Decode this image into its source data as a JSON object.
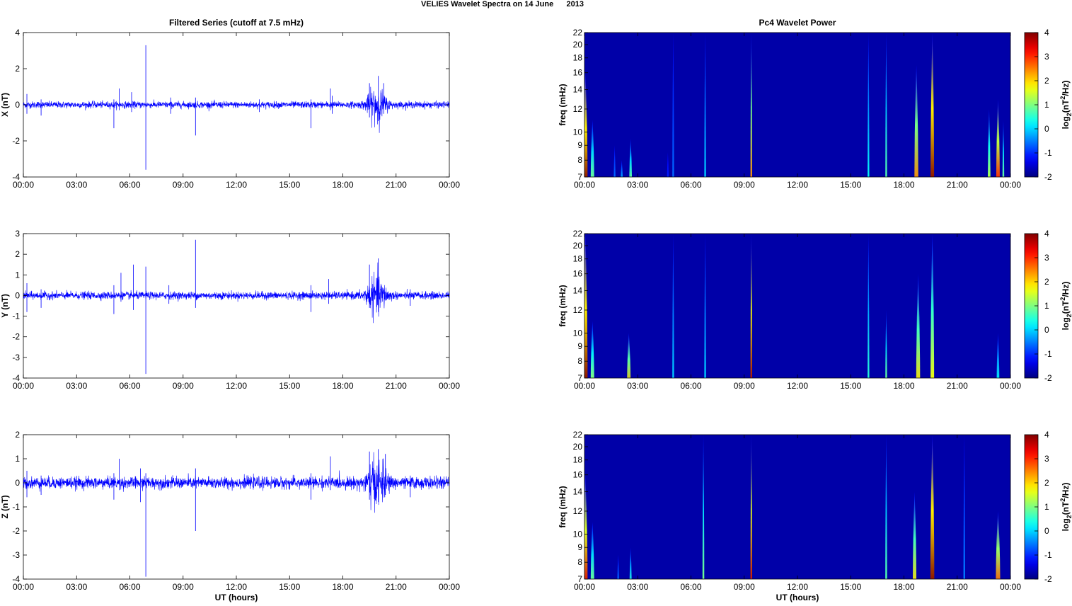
{
  "title": "VELIES Wavelet Spectra on 14 June      2013",
  "chart_data": [
    {
      "type": "line",
      "title": "Filtered Series (cutoff at 7.5 mHz)",
      "xlabel": "",
      "ylabel": "X (nT)",
      "xticks": [
        "00:00",
        "03:00",
        "06:00",
        "09:00",
        "12:00",
        "15:00",
        "18:00",
        "21:00",
        "00:00"
      ],
      "xlim": [
        0,
        24
      ],
      "ylim": [
        -4,
        4
      ],
      "yticks": [
        4,
        2,
        0,
        -2,
        -4
      ],
      "color": "#0000ff",
      "noise_std": 0.09,
      "burst": {
        "center_hour": 19.9,
        "width_hours": 0.5,
        "amplitude": 0.45
      },
      "spikes": [
        [
          0.2,
          0.6,
          -0.5
        ],
        [
          1.0,
          0.3,
          -0.6
        ],
        [
          5.1,
          0.3,
          -1.3
        ],
        [
          5.4,
          0.9,
          -0.3
        ],
        [
          6.1,
          0.7,
          -0.4
        ],
        [
          6.9,
          3.3,
          -3.6
        ],
        [
          8.3,
          0.4,
          -0.5
        ],
        [
          9.7,
          0.4,
          -1.7
        ],
        [
          13.3,
          0.3,
          -0.4
        ],
        [
          16.2,
          0.3,
          -1.3
        ],
        [
          17.3,
          0.9,
          -0.3
        ],
        [
          17.4,
          0.5,
          -0.5
        ],
        [
          19.5,
          1.2,
          -0.7
        ],
        [
          20.0,
          1.6,
          -0.9
        ],
        [
          20.3,
          1.2,
          -0.5
        ]
      ]
    },
    {
      "type": "line",
      "xlabel": "",
      "ylabel": "Y (nT)",
      "xticks": [
        "00:00",
        "03:00",
        "06:00",
        "09:00",
        "12:00",
        "15:00",
        "18:00",
        "21:00",
        "00:00"
      ],
      "xlim": [
        0,
        24
      ],
      "ylim": [
        -4,
        3
      ],
      "yticks": [
        3,
        2,
        1,
        0,
        -1,
        -2,
        -3,
        -4
      ],
      "color": "#0000ff",
      "noise_std": 0.09,
      "burst": {
        "center_hour": 19.9,
        "width_hours": 0.55,
        "amplitude": 0.4
      },
      "spikes": [
        [
          0.2,
          0.6,
          -0.8
        ],
        [
          1.0,
          0.3,
          -0.6
        ],
        [
          5.1,
          0.5,
          -0.9
        ],
        [
          5.5,
          1.1,
          -0.3
        ],
        [
          6.2,
          1.5,
          -0.7
        ],
        [
          6.9,
          1.4,
          -3.8
        ],
        [
          8.2,
          0.5,
          -0.4
        ],
        [
          9.7,
          2.7,
          -0.6
        ],
        [
          16.2,
          0.5,
          -0.8
        ],
        [
          17.2,
          0.8,
          -0.4
        ],
        [
          19.5,
          1.5,
          -0.6
        ],
        [
          20.0,
          1.8,
          -0.8
        ],
        [
          21.8,
          0.3,
          -0.5
        ]
      ]
    },
    {
      "type": "line",
      "xlabel": "UT (hours)",
      "ylabel": "Z (nT)",
      "xticks": [
        "00:00",
        "03:00",
        "06:00",
        "09:00",
        "12:00",
        "15:00",
        "18:00",
        "21:00",
        "00:00"
      ],
      "xlim": [
        0,
        24
      ],
      "ylim": [
        -4,
        2
      ],
      "yticks": [
        2,
        1,
        0,
        -1,
        -2,
        -3,
        -4
      ],
      "color": "#0000ff",
      "noise_std": 0.12,
      "burst": {
        "center_hour": 19.9,
        "width_hours": 0.55,
        "amplitude": 0.4
      },
      "spikes": [
        [
          0.2,
          0.5,
          -0.6
        ],
        [
          1.0,
          0.3,
          -0.5
        ],
        [
          5.1,
          0.4,
          -0.7
        ],
        [
          5.4,
          1.0,
          -0.3
        ],
        [
          6.6,
          0.6,
          -0.8
        ],
        [
          6.9,
          0.4,
          -3.9
        ],
        [
          9.7,
          0.6,
          -2.0
        ],
        [
          16.2,
          0.4,
          -0.7
        ],
        [
          17.3,
          1.1,
          -0.3
        ],
        [
          19.5,
          1.3,
          -0.7
        ],
        [
          20.0,
          1.4,
          -0.8
        ],
        [
          20.4,
          1.2,
          -0.5
        ],
        [
          21.8,
          0.3,
          -0.6
        ]
      ]
    },
    {
      "type": "heatmap",
      "title": "Pc4 Wavelet Power",
      "ylabel": "freq (mHz)",
      "xlabel": "",
      "xticks": [
        "00:00",
        "03:00",
        "06:00",
        "09:00",
        "12:00",
        "15:00",
        "18:00",
        "21:00",
        "00:00"
      ],
      "yticks": [
        7,
        8,
        9,
        10,
        12,
        14,
        16,
        18,
        20,
        22
      ],
      "ylim": [
        7,
        22
      ],
      "clim": [
        -2,
        4
      ],
      "cticks": [
        4,
        3,
        2,
        1,
        0,
        -1,
        -2
      ],
      "events": [
        [
          0.05,
          0.25,
          16,
          4
        ],
        [
          0.45,
          0.2,
          11,
          1
        ],
        [
          1.7,
          0.1,
          9,
          -0.5
        ],
        [
          2.1,
          0.12,
          8,
          0
        ],
        [
          2.6,
          0.15,
          9.5,
          1
        ],
        [
          4.7,
          0.1,
          8.5,
          -1
        ],
        [
          5.0,
          0.05,
          22,
          -0.6
        ],
        [
          6.8,
          0.05,
          22,
          0
        ],
        [
          9.4,
          0.06,
          22,
          2.5
        ],
        [
          16.0,
          0.05,
          22,
          0.3
        ],
        [
          17.0,
          0.08,
          22,
          0.8
        ],
        [
          18.7,
          0.22,
          17,
          2.5
        ],
        [
          19.6,
          0.2,
          22,
          4
        ],
        [
          22.8,
          0.15,
          12,
          1.5
        ],
        [
          23.3,
          0.2,
          13,
          3.2
        ],
        [
          23.6,
          0.1,
          11,
          1
        ]
      ]
    },
    {
      "type": "heatmap",
      "ylabel": "freq (mHz)",
      "xlabel": "",
      "xticks": [
        "00:00",
        "03:00",
        "06:00",
        "09:00",
        "12:00",
        "15:00",
        "18:00",
        "21:00",
        "00:00"
      ],
      "yticks": [
        7,
        8,
        9,
        10,
        12,
        14,
        16,
        18,
        20,
        22
      ],
      "ylim": [
        7,
        22
      ],
      "clim": [
        -2,
        4
      ],
      "cticks": [
        4,
        3,
        2,
        1,
        0,
        -1,
        -2
      ],
      "events": [
        [
          0.05,
          0.25,
          22,
          4
        ],
        [
          0.45,
          0.2,
          11,
          1.2
        ],
        [
          2.5,
          0.2,
          10,
          2.2
        ],
        [
          5.0,
          0.08,
          22,
          0
        ],
        [
          6.8,
          0.06,
          22,
          0
        ],
        [
          9.4,
          0.06,
          22,
          3.8
        ],
        [
          16.0,
          0.05,
          22,
          0.5
        ],
        [
          17.0,
          0.08,
          12,
          1
        ],
        [
          18.8,
          0.22,
          16,
          2
        ],
        [
          19.6,
          0.2,
          22,
          1.8
        ],
        [
          23.3,
          0.15,
          10,
          0.3
        ]
      ]
    },
    {
      "type": "heatmap",
      "xlabel": "UT (hours)",
      "ylabel": "freq (mHz)",
      "xticks": [
        "00:00",
        "03:00",
        "06:00",
        "09:00",
        "12:00",
        "15:00",
        "18:00",
        "21:00",
        "00:00"
      ],
      "yticks": [
        7,
        8,
        9,
        10,
        12,
        14,
        16,
        18,
        20,
        22
      ],
      "ylim": [
        7,
        22
      ],
      "clim": [
        -2,
        4
      ],
      "cticks": [
        4,
        3,
        2,
        1,
        0,
        -1,
        -2
      ],
      "events": [
        [
          0.05,
          0.25,
          16,
          3.5
        ],
        [
          0.45,
          0.2,
          11,
          1
        ],
        [
          1.9,
          0.1,
          8.5,
          -0.5
        ],
        [
          2.6,
          0.12,
          9,
          0.5
        ],
        [
          6.7,
          0.1,
          22,
          1
        ],
        [
          9.4,
          0.06,
          22,
          3.6
        ],
        [
          17.0,
          0.1,
          22,
          0.8
        ],
        [
          18.6,
          0.2,
          14,
          2
        ],
        [
          19.6,
          0.22,
          22,
          4
        ],
        [
          21.4,
          0.05,
          22,
          -0.5
        ],
        [
          23.3,
          0.25,
          12,
          2.8
        ]
      ]
    }
  ],
  "colorbar_label": {
    "base": "log",
    "sub": "2",
    "open": "(nT",
    "sup": "2",
    "close": "/Hz)"
  }
}
